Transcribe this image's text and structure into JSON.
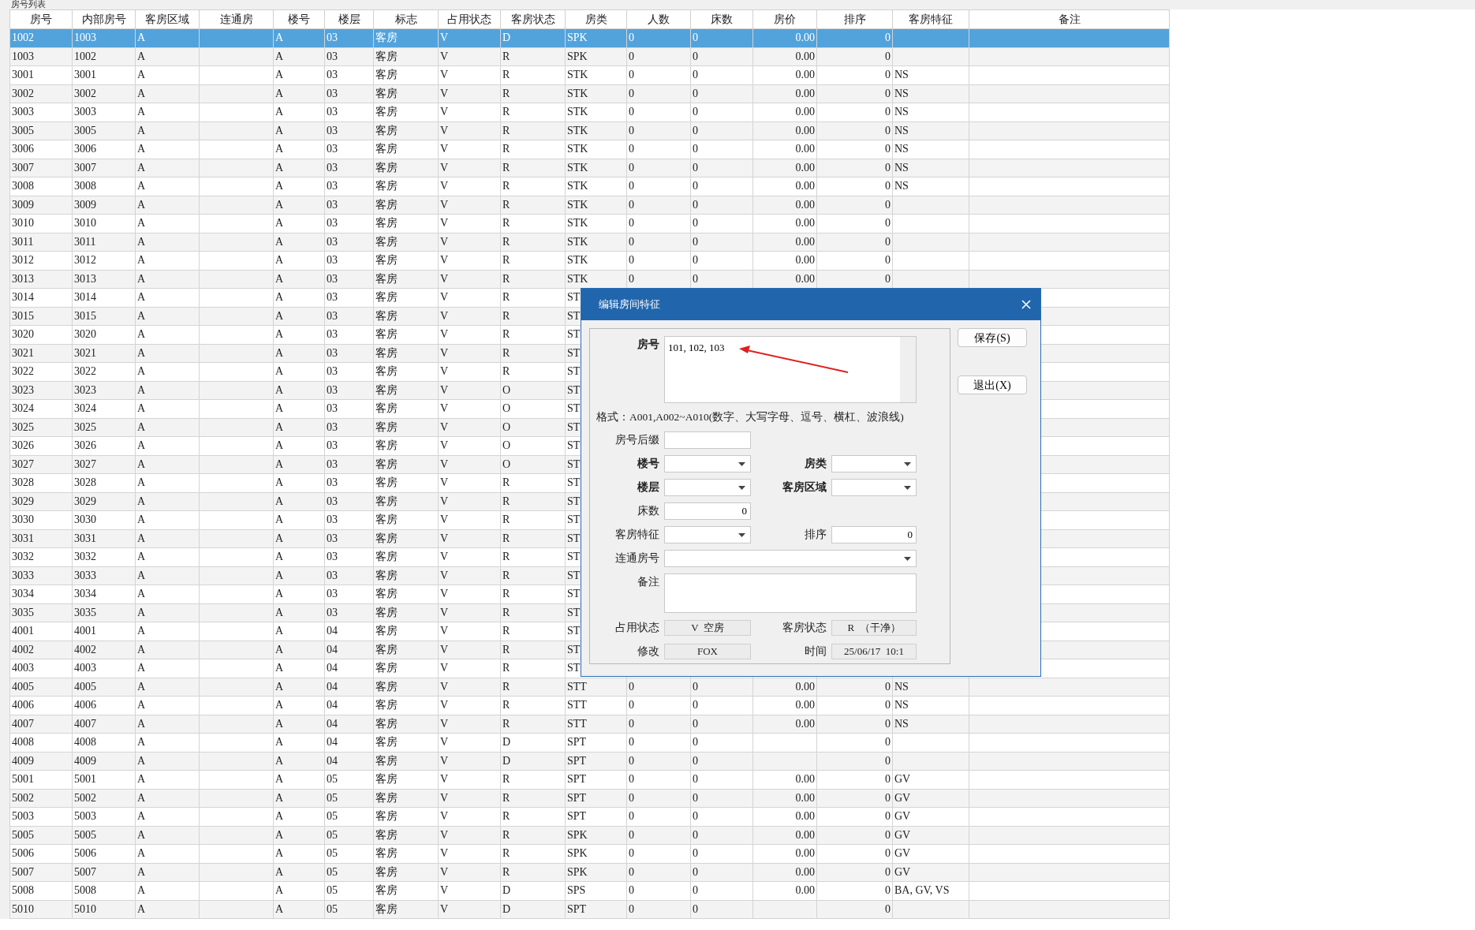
{
  "list_caption": "房号列表",
  "columns": [
    "房号",
    "内部房号",
    "客房区域",
    "连通房",
    "楼号",
    "楼层",
    "标志",
    "占用状态",
    "客房状态",
    "房类",
    "人数",
    "床数",
    "房价",
    "排序",
    "客房特征",
    "备注"
  ],
  "rows": [
    {
      "cells": [
        "1002",
        "1003",
        "A",
        null,
        "A",
        "03",
        "客房",
        "V",
        "D",
        "SPK",
        "0",
        "0",
        "0.00",
        "0"
      ],
      "selected": true
    },
    {
      "cells": [
        "1003",
        "1002",
        "A",
        null,
        "A",
        "03",
        "客房",
        "V",
        "R",
        "SPK",
        "0",
        "0",
        "0.00",
        "0"
      ],
      "selected": false
    },
    {
      "cells": [
        "3001",
        "3001",
        "A",
        null,
        "A",
        "03",
        "客房",
        "V",
        "R",
        "STK",
        "0",
        "0",
        "0.00",
        "0",
        "NS"
      ],
      "selected": false
    },
    {
      "cells": [
        "3002",
        "3002",
        "A",
        null,
        "A",
        "03",
        "客房",
        "V",
        "R",
        "STK",
        "0",
        "0",
        "0.00",
        "0",
        "NS"
      ],
      "selected": false
    },
    {
      "cells": [
        "3003",
        "3003",
        "A",
        null,
        "A",
        "03",
        "客房",
        "V",
        "R",
        "STK",
        "0",
        "0",
        "0.00",
        "0",
        "NS"
      ],
      "selected": false
    },
    {
      "cells": [
        "3005",
        "3005",
        "A",
        null,
        "A",
        "03",
        "客房",
        "V",
        "R",
        "STK",
        "0",
        "0",
        "0.00",
        "0",
        "NS"
      ],
      "selected": false
    },
    {
      "cells": [
        "3006",
        "3006",
        "A",
        null,
        "A",
        "03",
        "客房",
        "V",
        "R",
        "STK",
        "0",
        "0",
        "0.00",
        "0",
        "NS"
      ],
      "selected": false
    },
    {
      "cells": [
        "3007",
        "3007",
        "A",
        null,
        "A",
        "03",
        "客房",
        "V",
        "R",
        "STK",
        "0",
        "0",
        "0.00",
        "0",
        "NS"
      ],
      "selected": false
    },
    {
      "cells": [
        "3008",
        "3008",
        "A",
        null,
        "A",
        "03",
        "客房",
        "V",
        "R",
        "STK",
        "0",
        "0",
        "0.00",
        "0",
        "NS"
      ],
      "selected": false
    },
    {
      "cells": [
        "3009",
        "3009",
        "A",
        null,
        "A",
        "03",
        "客房",
        "V",
        "R",
        "STK",
        "0",
        "0",
        "0.00",
        "0"
      ],
      "selected": false
    },
    {
      "cells": [
        "3010",
        "3010",
        "A",
        null,
        "A",
        "03",
        "客房",
        "V",
        "R",
        "STK",
        "0",
        "0",
        "0.00",
        "0"
      ],
      "selected": false
    },
    {
      "cells": [
        "3011",
        "3011",
        "A",
        null,
        "A",
        "03",
        "客房",
        "V",
        "R",
        "STK",
        "0",
        "0",
        "0.00",
        "0"
      ],
      "selected": false
    },
    {
      "cells": [
        "3012",
        "3012",
        "A",
        null,
        "A",
        "03",
        "客房",
        "V",
        "R",
        "STK",
        "0",
        "0",
        "0.00",
        "0"
      ],
      "selected": false
    },
    {
      "cells": [
        "3013",
        "3013",
        "A",
        null,
        "A",
        "03",
        "客房",
        "V",
        "R",
        "STK",
        "0",
        "0",
        "0.00",
        "0"
      ],
      "selected": false
    },
    {
      "cells": [
        "3014",
        "3014",
        "A",
        null,
        "A",
        "03",
        "客房",
        "V",
        "R",
        "ST"
      ],
      "selected": false
    },
    {
      "cells": [
        "3015",
        "3015",
        "A",
        null,
        "A",
        "03",
        "客房",
        "V",
        "R",
        "ST"
      ],
      "selected": false
    },
    {
      "cells": [
        "3020",
        "3020",
        "A",
        null,
        "A",
        "03",
        "客房",
        "V",
        "R",
        "ST"
      ],
      "selected": false
    },
    {
      "cells": [
        "3021",
        "3021",
        "A",
        null,
        "A",
        "03",
        "客房",
        "V",
        "R",
        "ST"
      ],
      "selected": false
    },
    {
      "cells": [
        "3022",
        "3022",
        "A",
        null,
        "A",
        "03",
        "客房",
        "V",
        "R",
        "ST"
      ],
      "selected": false
    },
    {
      "cells": [
        "3023",
        "3023",
        "A",
        null,
        "A",
        "03",
        "客房",
        "V",
        "O",
        "ST"
      ],
      "selected": false
    },
    {
      "cells": [
        "3024",
        "3024",
        "A",
        null,
        "A",
        "03",
        "客房",
        "V",
        "O",
        "ST"
      ],
      "selected": false
    },
    {
      "cells": [
        "3025",
        "3025",
        "A",
        null,
        "A",
        "03",
        "客房",
        "V",
        "O",
        "ST"
      ],
      "selected": false
    },
    {
      "cells": [
        "3026",
        "3026",
        "A",
        null,
        "A",
        "03",
        "客房",
        "V",
        "O",
        "ST"
      ],
      "selected": false
    },
    {
      "cells": [
        "3027",
        "3027",
        "A",
        null,
        "A",
        "03",
        "客房",
        "V",
        "O",
        "ST"
      ],
      "selected": false
    },
    {
      "cells": [
        "3028",
        "3028",
        "A",
        null,
        "A",
        "03",
        "客房",
        "V",
        "R",
        "ST"
      ],
      "selected": false
    },
    {
      "cells": [
        "3029",
        "3029",
        "A",
        null,
        "A",
        "03",
        "客房",
        "V",
        "R",
        "ST"
      ],
      "selected": false
    },
    {
      "cells": [
        "3030",
        "3030",
        "A",
        null,
        "A",
        "03",
        "客房",
        "V",
        "R",
        "ST"
      ],
      "selected": false
    },
    {
      "cells": [
        "3031",
        "3031",
        "A",
        null,
        "A",
        "03",
        "客房",
        "V",
        "R",
        "ST"
      ],
      "selected": false
    },
    {
      "cells": [
        "3032",
        "3032",
        "A",
        null,
        "A",
        "03",
        "客房",
        "V",
        "R",
        "ST"
      ],
      "selected": false
    },
    {
      "cells": [
        "3033",
        "3033",
        "A",
        null,
        "A",
        "03",
        "客房",
        "V",
        "R",
        "ST"
      ],
      "selected": false
    },
    {
      "cells": [
        "3034",
        "3034",
        "A",
        null,
        "A",
        "03",
        "客房",
        "V",
        "R",
        "ST"
      ],
      "selected": false
    },
    {
      "cells": [
        "3035",
        "3035",
        "A",
        null,
        "A",
        "03",
        "客房",
        "V",
        "R",
        "ST"
      ],
      "selected": false
    },
    {
      "cells": [
        "4001",
        "4001",
        "A",
        null,
        "A",
        "04",
        "客房",
        "V",
        "R",
        "ST"
      ],
      "selected": false
    },
    {
      "cells": [
        "4002",
        "4002",
        "A",
        null,
        "A",
        "04",
        "客房",
        "V",
        "R",
        "ST"
      ],
      "selected": false
    },
    {
      "cells": [
        "4003",
        "4003",
        "A",
        null,
        "A",
        "04",
        "客房",
        "V",
        "R",
        "ST"
      ],
      "selected": false
    },
    {
      "cells": [
        "4005",
        "4005",
        "A",
        null,
        "A",
        "04",
        "客房",
        "V",
        "R",
        "STT",
        "0",
        "0",
        "0.00",
        "0",
        "NS"
      ],
      "selected": false
    },
    {
      "cells": [
        "4006",
        "4006",
        "A",
        null,
        "A",
        "04",
        "客房",
        "V",
        "R",
        "STT",
        "0",
        "0",
        "0.00",
        "0",
        "NS"
      ],
      "selected": false
    },
    {
      "cells": [
        "4007",
        "4007",
        "A",
        null,
        "A",
        "04",
        "客房",
        "V",
        "R",
        "STT",
        "0",
        "0",
        "0.00",
        "0",
        "NS"
      ],
      "selected": false
    },
    {
      "cells": [
        "4008",
        "4008",
        "A",
        null,
        "A",
        "04",
        "客房",
        "V",
        "D",
        "SPT",
        "0",
        "0",
        null,
        "0"
      ],
      "selected": false
    },
    {
      "cells": [
        "4009",
        "4009",
        "A",
        null,
        "A",
        "04",
        "客房",
        "V",
        "D",
        "SPT",
        "0",
        "0",
        null,
        "0"
      ],
      "selected": false
    },
    {
      "cells": [
        "5001",
        "5001",
        "A",
        null,
        "A",
        "05",
        "客房",
        "V",
        "R",
        "SPT",
        "0",
        "0",
        "0.00",
        "0",
        "GV"
      ],
      "selected": false
    },
    {
      "cells": [
        "5002",
        "5002",
        "A",
        null,
        "A",
        "05",
        "客房",
        "V",
        "R",
        "SPT",
        "0",
        "0",
        "0.00",
        "0",
        "GV"
      ],
      "selected": false
    },
    {
      "cells": [
        "5003",
        "5003",
        "A",
        null,
        "A",
        "05",
        "客房",
        "V",
        "R",
        "SPT",
        "0",
        "0",
        "0.00",
        "0",
        "GV"
      ],
      "selected": false
    },
    {
      "cells": [
        "5005",
        "5005",
        "A",
        null,
        "A",
        "05",
        "客房",
        "V",
        "R",
        "SPK",
        "0",
        "0",
        "0.00",
        "0",
        "GV"
      ],
      "selected": false
    },
    {
      "cells": [
        "5006",
        "5006",
        "A",
        null,
        "A",
        "05",
        "客房",
        "V",
        "R",
        "SPK",
        "0",
        "0",
        "0.00",
        "0",
        "GV"
      ],
      "selected": false
    },
    {
      "cells": [
        "5007",
        "5007",
        "A",
        null,
        "A",
        "05",
        "客房",
        "V",
        "R",
        "SPK",
        "0",
        "0",
        "0.00",
        "0",
        "GV"
      ],
      "selected": false
    },
    {
      "cells": [
        "5008",
        "5008",
        "A",
        null,
        "A",
        "05",
        "客房",
        "V",
        "D",
        "SPS",
        "0",
        "0",
        "0.00",
        "0",
        "BA, GV, VS"
      ],
      "selected": false
    },
    {
      "cells": [
        "5010",
        "5010",
        "A",
        null,
        "A",
        "05",
        "客房",
        "V",
        "D",
        "SPT",
        "0",
        "0",
        null,
        "0"
      ],
      "selected": false
    }
  ],
  "dialog": {
    "title": "编辑房间特征",
    "room_no": {
      "label": "房号",
      "value": "101, 102, 103",
      "required": true
    },
    "format_hint": "格式：A001,A002~A010(数字、大写字母、逗号、横杠、波浪线)",
    "fields": [
      [
        {
          "label": "房号后缀",
          "kind": "text",
          "required": false,
          "wide": false
        }
      ],
      [
        {
          "label": "楼号",
          "kind": "combo",
          "required": true,
          "wide": false
        },
        {
          "label": "房类",
          "kind": "combo",
          "required": true,
          "wide": false
        }
      ],
      [
        {
          "label": "楼层",
          "kind": "combo",
          "required": true,
          "wide": false
        },
        {
          "label": "客房区域",
          "kind": "combo",
          "required": true,
          "wide": false
        }
      ],
      [
        {
          "label": "床数",
          "kind": "number",
          "value": "0",
          "required": false,
          "wide": false
        }
      ],
      [
        {
          "label": "客房特征",
          "kind": "combo",
          "required": false,
          "wide": false
        },
        {
          "label": "排序",
          "kind": "number",
          "value": "0",
          "required": false,
          "wide": false
        }
      ],
      [
        {
          "label": "连通房号",
          "kind": "combo",
          "required": false,
          "wide": true
        }
      ],
      [
        {
          "label": "备注",
          "kind": "memo",
          "required": false,
          "wide": true
        }
      ],
      [
        {
          "label": "占用状态",
          "kind": "readonly",
          "value": "V  空房",
          "required": false,
          "wide": false
        },
        {
          "label": "客房状态",
          "kind": "readonly",
          "value": "R  （干净）",
          "required": false,
          "wide": false
        }
      ],
      [
        {
          "label": "修改",
          "kind": "readonly",
          "value": "FOX",
          "required": false,
          "wide": false
        },
        {
          "label": "时间",
          "kind": "readonly",
          "value": "25/06/17  10:1",
          "required": false,
          "wide": false
        }
      ]
    ],
    "buttons": [
      "保存(S)",
      "退出(X)"
    ]
  }
}
